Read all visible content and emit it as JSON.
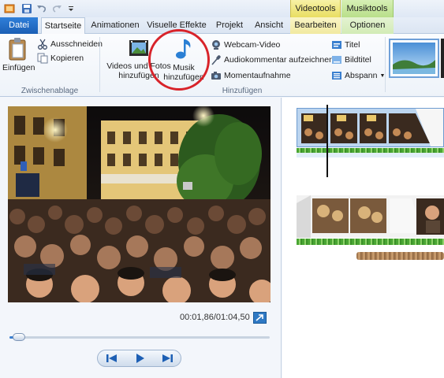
{
  "quick_access": {
    "save": "save-icon",
    "undo": "undo-icon",
    "redo": "redo-icon",
    "customize": "chevron-down-icon"
  },
  "context_tabs": {
    "video_tools": "Videotools",
    "music_tools": "Musiktools"
  },
  "tabs": {
    "file": "Datei",
    "home": "Startseite",
    "animations": "Animationen",
    "visual_effects": "Visuelle Effekte",
    "project": "Projekt",
    "view": "Ansicht",
    "edit": "Bearbeiten",
    "options": "Optionen"
  },
  "ribbon": {
    "clipboard": {
      "paste": "Einfügen",
      "cut": "Ausschneiden",
      "copy": "Kopieren",
      "group": "Zwischenablage"
    },
    "add": {
      "videos_photos_line1": "Videos und Fotos",
      "videos_photos_line2": "hinzufügen",
      "music_line1": "Musik",
      "music_line2": "hinzufügen",
      "webcam": "Webcam-Video",
      "narration": "Audiokommentar aufzeichnen",
      "snapshot": "Momentaufnahme",
      "title": "Titel",
      "caption": "Bildtitel",
      "credits": "Abspann",
      "group": "Hinzufügen"
    }
  },
  "player": {
    "timecode": "00:01,86/01:04,50",
    "progress": 0.03
  },
  "colors": {
    "accent": "#1b5fb5",
    "highlight_circle": "#d8232a",
    "video_tools": "#e9de62",
    "music_tools": "#b9df8a"
  }
}
